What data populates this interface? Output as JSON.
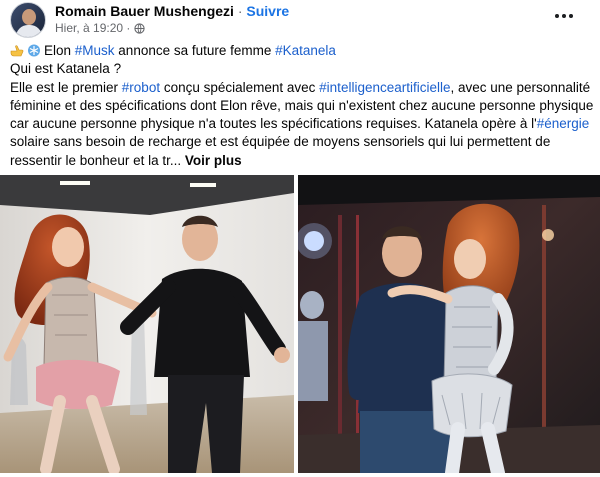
{
  "header": {
    "author_name": "Romain Bauer Mushengezi",
    "separator": "·",
    "follow_label": "Suivre",
    "timestamp": "Hier, à 19:20 ·",
    "privacy_icon": "globe-icon",
    "more_icon": "more-options-icon"
  },
  "post": {
    "line1": {
      "emoji1": "pointing-hand-emoji",
      "emoji2": "snowflake-emoji",
      "pre": "Elon ",
      "tag1": "#Musk",
      "mid": " annonce sa future femme ",
      "tag2": "#Katanela"
    },
    "line2": "Qui est Katanela ?",
    "line3": {
      "pre": "Elle est le premier ",
      "tag1": "#robot",
      "mid": " conçu spécialement avec ",
      "tag2": "#intelligenceartificielle",
      "post": ", avec une personnalité"
    },
    "line4": "féminine et des spécifications dont Elon rêve, mais qui n'existent chez aucune personne physique",
    "line5": {
      "pre": "car aucune personne physique n'a toutes les spécifications requises. Katanela opère à l'",
      "tag": "#énergie"
    },
    "line6": "solaire sans besoin de recharge et est équipée de moyens sensoriels qui lui permettent de",
    "line7": {
      "pre": "ressentir le bonheur et la tr... ",
      "see_more": "Voir plus"
    }
  },
  "colors": {
    "hashtag": "#1b5fcc",
    "follow": "#1b74e4",
    "meta_text": "#65676b"
  },
  "photos": [
    {
      "name": "photo-dancing-gallery"
    },
    {
      "name": "photo-dancing-robot-lab"
    }
  ]
}
